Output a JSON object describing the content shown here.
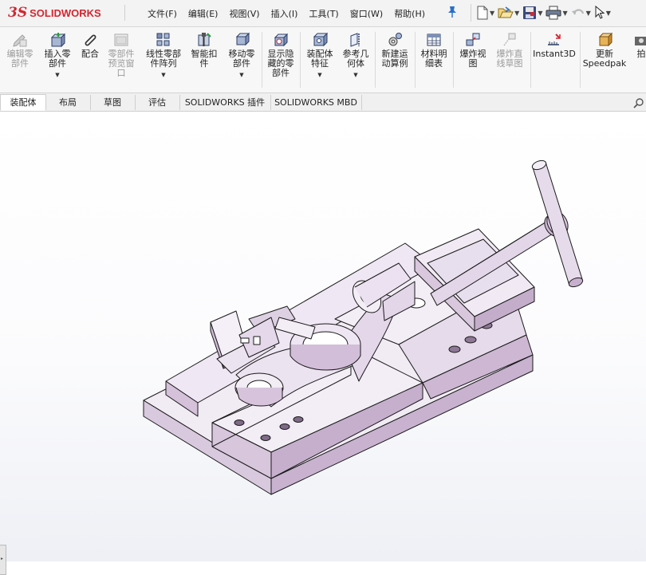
{
  "app": {
    "logo_ds": "3S",
    "logo_brand": "SOLIDWORKS",
    "brand_color": "#d22630"
  },
  "menu": [
    "文件(F)",
    "编辑(E)",
    "视图(V)",
    "插入(I)",
    "工具(T)",
    "窗口(W)",
    "帮助(H)"
  ],
  "ribbon": {
    "edit_component": "编辑零\n部件",
    "insert_components": "插入零\n部件",
    "mate": "配合",
    "component_preview": "零部件\n预览窗\n口",
    "linear_pattern": "线性零部\n件阵列",
    "smart_fasteners": "智能扣\n件",
    "move_component": "移动零\n部件",
    "show_hidden": "显示隐\n藏的零\n部件",
    "assembly_features": "装配体\n特征",
    "reference_geometry": "参考几\n何体",
    "new_motion_study": "新建运\n动算例",
    "bom": "材料明\n细表",
    "exploded_view": "爆炸视\n图",
    "explode_line_sketch": "爆炸直\n线草图",
    "instant3d": "Instant3D",
    "update_speedpak": "更新\nSpeedpak",
    "truncated": "拍"
  },
  "tabs": [
    "装配体",
    "布局",
    "草图",
    "评估",
    "SOLIDWORKS 插件",
    "SOLIDWORKS MBD"
  ],
  "colors": {
    "part_face": "#efe8f3",
    "part_side": "#cdb8d2",
    "part_dark": "#a58cad",
    "edge": "#1a1a1a"
  }
}
